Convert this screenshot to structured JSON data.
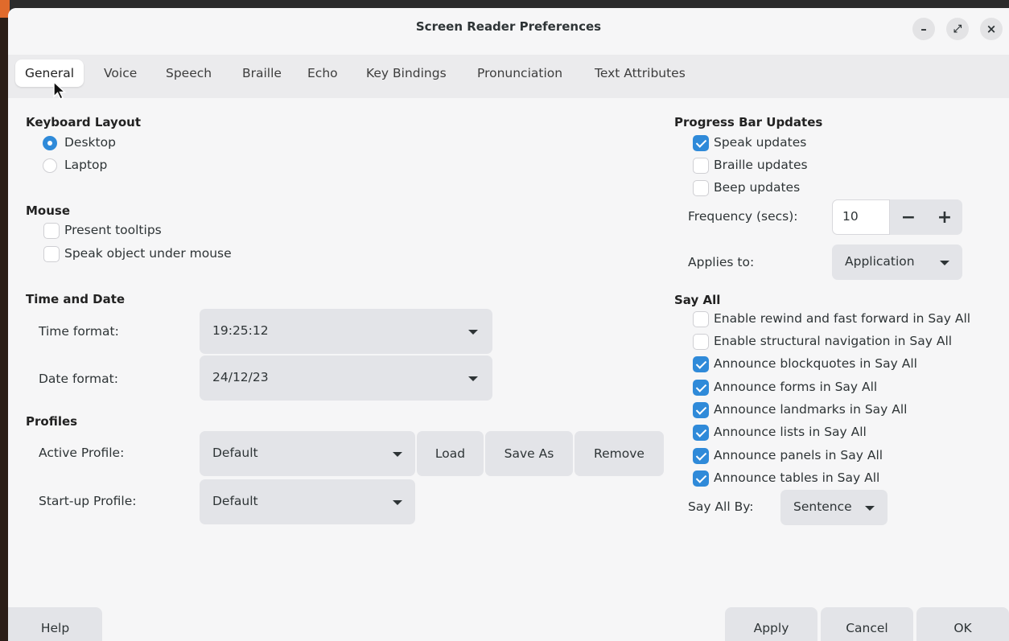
{
  "window": {
    "title": "Screen Reader Preferences",
    "controls": {
      "minimize": "–",
      "maximize": "⤢",
      "close": "×"
    }
  },
  "tabs": [
    {
      "label": "General",
      "active": true
    },
    {
      "label": "Voice"
    },
    {
      "label": "Speech"
    },
    {
      "label": "Braille"
    },
    {
      "label": "Echo"
    },
    {
      "label": "Key Bindings"
    },
    {
      "label": "Pronunciation"
    },
    {
      "label": "Text Attributes"
    }
  ],
  "keyboard_layout": {
    "heading": "Keyboard Layout",
    "options": [
      {
        "label": "Desktop",
        "selected": true
      },
      {
        "label": "Laptop",
        "selected": false
      }
    ]
  },
  "mouse": {
    "heading": "Mouse",
    "present_tooltips": {
      "label": "Present tooltips",
      "checked": false
    },
    "speak_object": {
      "label": "Speak object under mouse",
      "checked": false
    }
  },
  "time_date": {
    "heading": "Time and Date",
    "time_label": "Time format:",
    "time_value": "19:25:12",
    "date_label": "Date format:",
    "date_value": "24/12/23"
  },
  "profiles": {
    "heading": "Profiles",
    "active_label": "Active Profile:",
    "active_value": "Default",
    "load": "Load",
    "save_as": "Save As",
    "remove": "Remove",
    "startup_label": "Start-up Profile:",
    "startup_value": "Default"
  },
  "progress": {
    "heading": "Progress Bar Updates",
    "speak": {
      "label": "Speak updates",
      "checked": true
    },
    "braille": {
      "label": "Braille updates",
      "checked": false
    },
    "beep": {
      "label": "Beep updates",
      "checked": false
    },
    "frequency_label": "Frequency (secs):",
    "frequency_value": "10",
    "minus": "−",
    "plus": "+",
    "applies_label": "Applies to:",
    "applies_value": "Application"
  },
  "say_all": {
    "heading": "Say All",
    "items": [
      {
        "label": "Enable rewind and fast forward in Say All",
        "checked": false
      },
      {
        "label": "Enable structural navigation in Say All",
        "checked": false
      },
      {
        "label": "Announce blockquotes in Say All",
        "checked": true
      },
      {
        "label": "Announce forms in Say All",
        "checked": true
      },
      {
        "label": "Announce landmarks in Say All",
        "checked": true
      },
      {
        "label": "Announce lists in Say All",
        "checked": true
      },
      {
        "label": "Announce panels in Say All",
        "checked": true
      },
      {
        "label": "Announce tables in Say All",
        "checked": true
      }
    ],
    "by_label": "Say All By:",
    "by_value": "Sentence"
  },
  "footer": {
    "help": "Help",
    "apply": "Apply",
    "cancel": "Cancel",
    "ok": "OK"
  },
  "colors": {
    "accent": "#2f8ad9",
    "window_bg": "#f6f6f7",
    "tabbar_bg": "#ebebed",
    "button_bg": "#e3e4e8"
  }
}
